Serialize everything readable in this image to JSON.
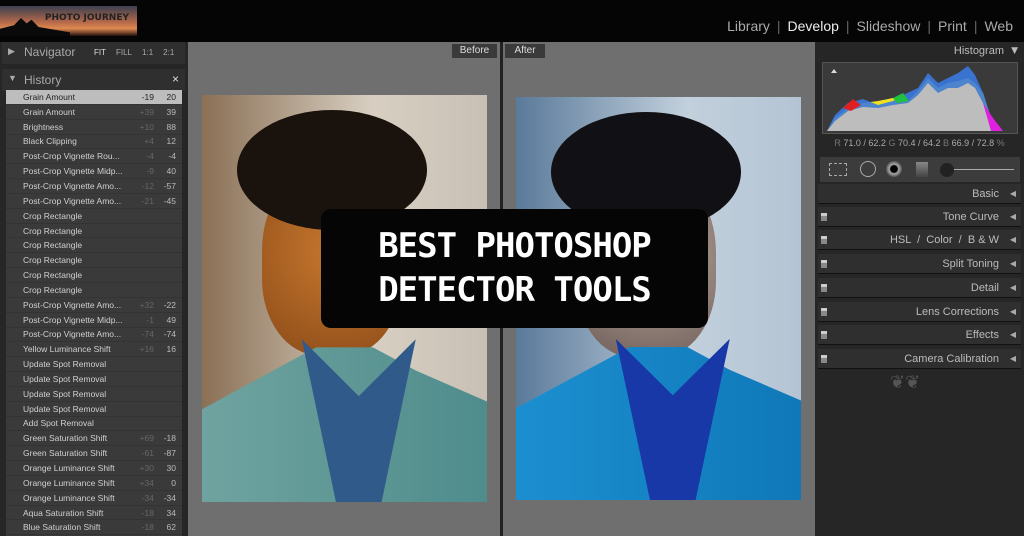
{
  "logo": {
    "text": "PHOTO JOURNEY"
  },
  "modules": [
    {
      "label": "Library"
    },
    {
      "label": "Develop",
      "active": true
    },
    {
      "label": "Slideshow"
    },
    {
      "label": "Print"
    },
    {
      "label": "Web"
    }
  ],
  "navigator": {
    "title": "Navigator",
    "zoom_options": [
      "FIT",
      "FILL",
      "1:1",
      "2:1"
    ]
  },
  "history": {
    "title": "History",
    "close": "×",
    "items": [
      {
        "name": "Grain Amount",
        "a": "-19",
        "b": "20",
        "selected": true
      },
      {
        "name": "Grain Amount",
        "a": "+39",
        "b": "39"
      },
      {
        "name": "Brightness",
        "a": "+10",
        "b": "88"
      },
      {
        "name": "Black Clipping",
        "a": "+4",
        "b": "12"
      },
      {
        "name": "Post-Crop Vignette Rou...",
        "a": "-4",
        "b": "-4"
      },
      {
        "name": "Post-Crop Vignette Midp...",
        "a": "-9",
        "b": "40"
      },
      {
        "name": "Post-Crop Vignette Amo...",
        "a": "-12",
        "b": "-57"
      },
      {
        "name": "Post-Crop Vignette Amo...",
        "a": "-21",
        "b": "-45"
      },
      {
        "name": "Crop Rectangle",
        "a": "",
        "b": ""
      },
      {
        "name": "Crop Rectangle",
        "a": "",
        "b": ""
      },
      {
        "name": "Crop Rectangle",
        "a": "",
        "b": ""
      },
      {
        "name": "Crop Rectangle",
        "a": "",
        "b": ""
      },
      {
        "name": "Crop Rectangle",
        "a": "",
        "b": ""
      },
      {
        "name": "Crop Rectangle",
        "a": "",
        "b": ""
      },
      {
        "name": "Post-Crop Vignette Amo...",
        "a": "+32",
        "b": "-22"
      },
      {
        "name": "Post-Crop Vignette Midp...",
        "a": "-1",
        "b": "49"
      },
      {
        "name": "Post-Crop Vignette Amo...",
        "a": "-74",
        "b": "-74"
      },
      {
        "name": "Yellow Luminance Shift",
        "a": "+16",
        "b": "16"
      },
      {
        "name": "Update Spot Removal",
        "a": "",
        "b": ""
      },
      {
        "name": "Update Spot Removal",
        "a": "",
        "b": ""
      },
      {
        "name": "Update Spot Removal",
        "a": "",
        "b": ""
      },
      {
        "name": "Update Spot Removal",
        "a": "",
        "b": ""
      },
      {
        "name": "Add Spot Removal",
        "a": "",
        "b": ""
      },
      {
        "name": "Green Saturation Shift",
        "a": "+69",
        "b": "-18"
      },
      {
        "name": "Green Saturation Shift",
        "a": "-61",
        "b": "-87"
      },
      {
        "name": "Orange Luminance Shift",
        "a": "+30",
        "b": "30"
      },
      {
        "name": "Orange Luminance Shift",
        "a": "+34",
        "b": "0"
      },
      {
        "name": "Orange Luminance Shift",
        "a": "-34",
        "b": "-34"
      },
      {
        "name": "Aqua Saturation Shift",
        "a": "-18",
        "b": "34"
      },
      {
        "name": "Blue Saturation Shift",
        "a": "-18",
        "b": "62"
      }
    ]
  },
  "compare": {
    "before": "Before",
    "after": "After"
  },
  "overlay": {
    "line1": "BEST PHOTOSHOP",
    "line2": "DETECTOR TOOLS"
  },
  "histogram": {
    "title": "Histogram",
    "readout": {
      "r_label": "R",
      "r": "71.0 / 62.2",
      "g_label": "G",
      "g": "70.4 / 64.2",
      "b_label": "B",
      "b": "66.9 / 72.8",
      "unit": "%"
    }
  },
  "panels": [
    {
      "label": "Basic",
      "switch": false
    },
    {
      "label": "Tone Curve",
      "switch": true
    },
    {
      "label": "HSL  /  Color  /  B & W",
      "switch": true
    },
    {
      "label": "Split Toning",
      "switch": true
    },
    {
      "label": "Detail",
      "switch": true
    },
    {
      "label": "Lens Corrections",
      "switch": true
    },
    {
      "label": "Effects",
      "switch": true
    },
    {
      "label": "Camera Calibration",
      "switch": true
    }
  ]
}
